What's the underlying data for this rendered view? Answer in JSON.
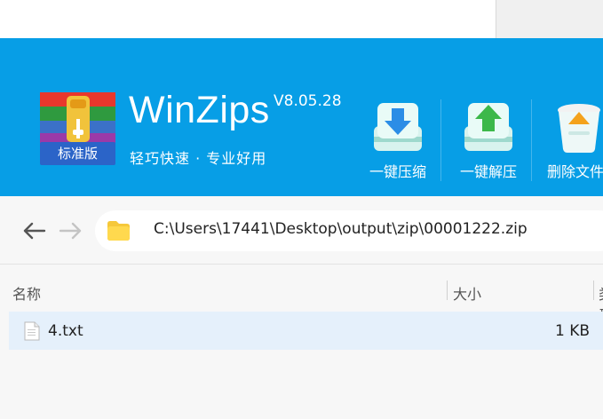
{
  "app": {
    "name": "WinZips",
    "version": "V8.05.28",
    "tagline": "轻巧快速 · 专业好用",
    "edition_badge": "标准版"
  },
  "toolbar": {
    "compress_label": "一键压缩",
    "extract_label": "一键解压",
    "delete_label": "删除文件"
  },
  "address": {
    "path": "C:\\Users\\17441\\Desktop\\output\\zip\\00001222.zip"
  },
  "columns": {
    "name": "名称",
    "size": "大小",
    "third": "类型"
  },
  "files": [
    {
      "name": "4.txt",
      "size": "1 KB"
    }
  ],
  "colors": {
    "header_blue": "#079ee6",
    "row_selected": "#e5f0fb"
  },
  "icons": [
    "back-arrow-icon",
    "forward-arrow-icon",
    "folder-icon",
    "text-file-icon",
    "compress-icon",
    "extract-icon",
    "recycle-bin-icon"
  ]
}
